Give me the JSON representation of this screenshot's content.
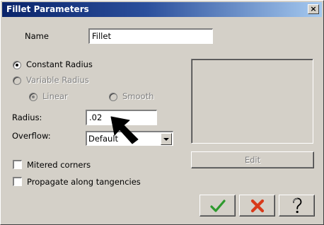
{
  "window": {
    "title": "Fillet Parameters",
    "close_glyph": "×"
  },
  "name": {
    "label": "Name",
    "value": "Fillet"
  },
  "radius_mode": {
    "constant_label": "Constant Radius",
    "variable_label": "Variable Radius",
    "linear_label": "Linear",
    "smooth_label": "Smooth",
    "selected": "Constant Radius"
  },
  "radius": {
    "label": "Radius:",
    "value": ".02"
  },
  "overflow": {
    "label": "Overflow:",
    "value": "Default"
  },
  "options": {
    "mitered_label": "Mitered corners",
    "mitered_checked": false,
    "propagate_label": "Propagate along tangencies",
    "propagate_checked": false
  },
  "buttons": {
    "edit_label": "Edit",
    "ok_icon": "checkmark-icon",
    "cancel_icon": "red-x-icon",
    "help_icon": "question-mark-icon"
  },
  "colors": {
    "title_bar": "#0a246a",
    "ok_green": "#2e9a2e",
    "cancel_red": "#d83a1a"
  }
}
